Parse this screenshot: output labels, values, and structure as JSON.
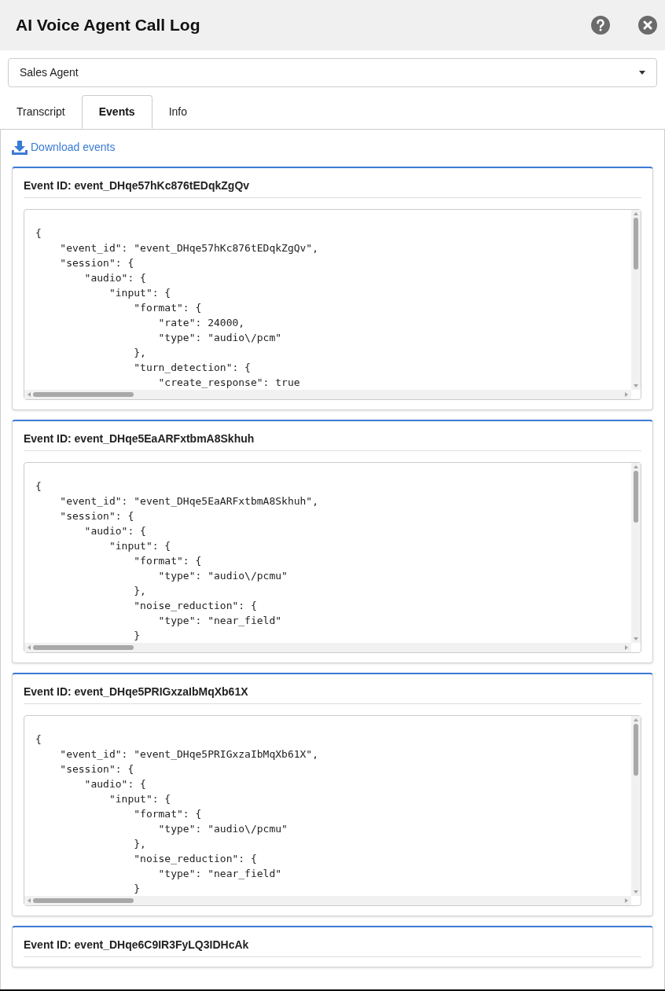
{
  "window": {
    "title": "AI Voice Agent Call Log"
  },
  "agent_select": {
    "value": "Sales Agent"
  },
  "tabs": [
    {
      "label": "Transcript",
      "selected": false
    },
    {
      "label": "Events",
      "selected": true
    },
    {
      "label": "Info",
      "selected": false
    }
  ],
  "download_link": "Download events",
  "events": [
    {
      "title": "Event ID: event_DHqe57hKc876tEDqkZgQv",
      "json": "{\n    \"event_id\": \"event_DHqe57hKc876tEDqkZgQv\",\n    \"session\": {\n        \"audio\": {\n            \"input\": {\n                \"format\": {\n                    \"rate\": 24000,\n                    \"type\": \"audio\\/pcm\"\n                },\n                \"turn_detection\": {\n                    \"create_response\": true"
    },
    {
      "title": "Event ID: event_DHqe5EaARFxtbmA8Skhuh",
      "json": "{\n    \"event_id\": \"event_DHqe5EaARFxtbmA8Skhuh\",\n    \"session\": {\n        \"audio\": {\n            \"input\": {\n                \"format\": {\n                    \"type\": \"audio\\/pcmu\"\n                },\n                \"noise_reduction\": {\n                    \"type\": \"near_field\"\n                }"
    },
    {
      "title": "Event ID: event_DHqe5PRIGxzaIbMqXb61X",
      "json": "{\n    \"event_id\": \"event_DHqe5PRIGxzaIbMqXb61X\",\n    \"session\": {\n        \"audio\": {\n            \"input\": {\n                \"format\": {\n                    \"type\": \"audio\\/pcmu\"\n                },\n                \"noise_reduction\": {\n                    \"type\": \"near_field\"\n                }"
    },
    {
      "title": "Event ID: event_DHqe6C9IR3FyLQ3IDHcAk"
    }
  ]
}
